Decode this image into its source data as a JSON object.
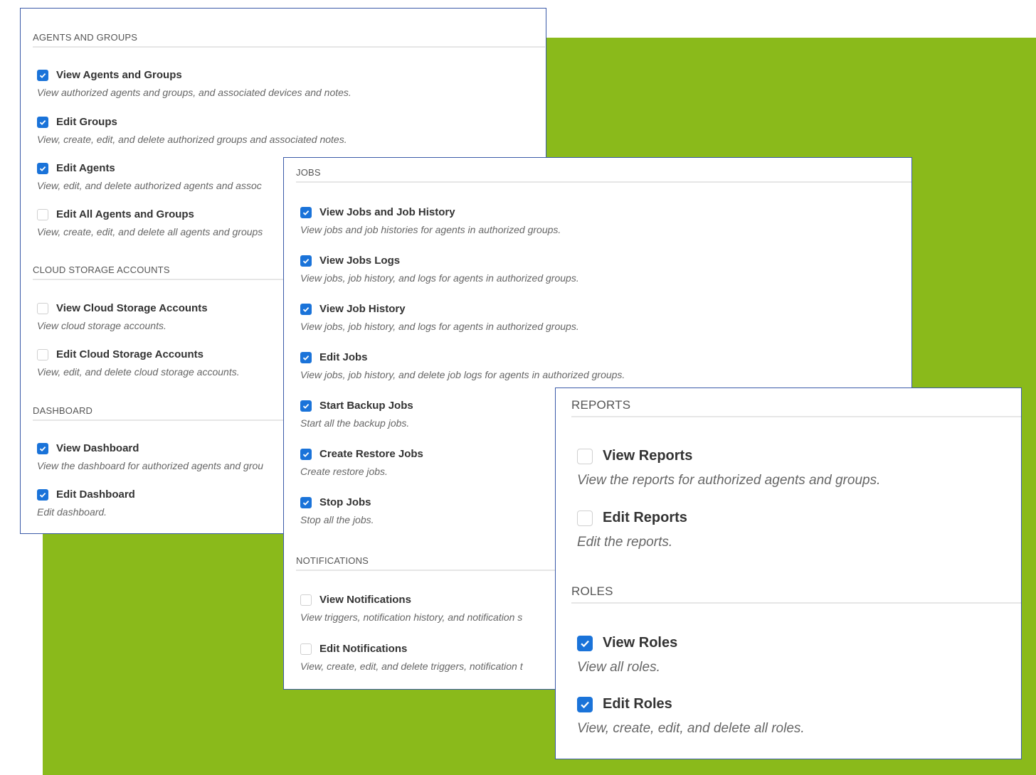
{
  "agents_groups": {
    "title": "AGENTS AND GROUPS",
    "items": [
      {
        "label": "View Agents and Groups",
        "desc": "View authorized agents and groups, and associated devices and notes.",
        "checked": true
      },
      {
        "label": "Edit Groups",
        "desc": "View, create, edit, and delete authorized groups and associated notes.",
        "checked": true
      },
      {
        "label": "Edit Agents",
        "desc": "View, edit, and delete authorized agents and assoc",
        "checked": true
      },
      {
        "label": "Edit All Agents and Groups",
        "desc": "View, create, edit, and delete all agents and groups",
        "checked": false
      }
    ]
  },
  "cloud_storage": {
    "title": "CLOUD STORAGE ACCOUNTS",
    "items": [
      {
        "label": "View Cloud Storage Accounts",
        "desc": "View cloud storage accounts.",
        "checked": false
      },
      {
        "label": "Edit Cloud Storage Accounts",
        "desc": "View, edit, and delete cloud storage accounts.",
        "checked": false
      }
    ]
  },
  "dashboard": {
    "title": "DASHBOARD",
    "items": [
      {
        "label": "View Dashboard",
        "desc": "View the dashboard for authorized agents and grou",
        "checked": true
      },
      {
        "label": "Edit Dashboard",
        "desc": "Edit dashboard.",
        "checked": true
      }
    ]
  },
  "jobs": {
    "title": "JOBS",
    "items": [
      {
        "label": "View Jobs and Job History",
        "desc": "View jobs and job histories for agents in authorized groups.",
        "checked": true
      },
      {
        "label": "View Jobs Logs",
        "desc": "View jobs, job history, and logs for agents in authorized groups.",
        "checked": true
      },
      {
        "label": "View Job History",
        "desc": "View jobs, job history, and logs for agents in authorized groups.",
        "checked": true
      },
      {
        "label": "Edit Jobs",
        "desc": "View jobs, job history, and delete job logs for agents in authorized groups.",
        "checked": true
      },
      {
        "label": "Start Backup Jobs",
        "desc": "Start all the backup jobs.",
        "checked": true
      },
      {
        "label": "Create Restore Jobs",
        "desc": "Create restore jobs.",
        "checked": true
      },
      {
        "label": "Stop Jobs",
        "desc": "Stop all the jobs.",
        "checked": true
      }
    ]
  },
  "notifications": {
    "title": "NOTIFICATIONS",
    "items": [
      {
        "label": "View Notifications",
        "desc": "View triggers, notification history, and notification s",
        "checked": false
      },
      {
        "label": "Edit Notifications",
        "desc": "View, create, edit, and delete triggers, notification t",
        "checked": false
      }
    ]
  },
  "reports": {
    "title": "REPORTS",
    "items": [
      {
        "label": "View Reports",
        "desc": "View the reports for authorized agents and groups.",
        "checked": false
      },
      {
        "label": "Edit Reports",
        "desc": "Edit the reports.",
        "checked": false
      }
    ]
  },
  "roles": {
    "title": "ROLES",
    "items": [
      {
        "label": "View Roles",
        "desc": "View all roles.",
        "checked": true
      },
      {
        "label": "Edit Roles",
        "desc": "View, create, edit, and delete all roles.",
        "checked": true
      }
    ]
  }
}
